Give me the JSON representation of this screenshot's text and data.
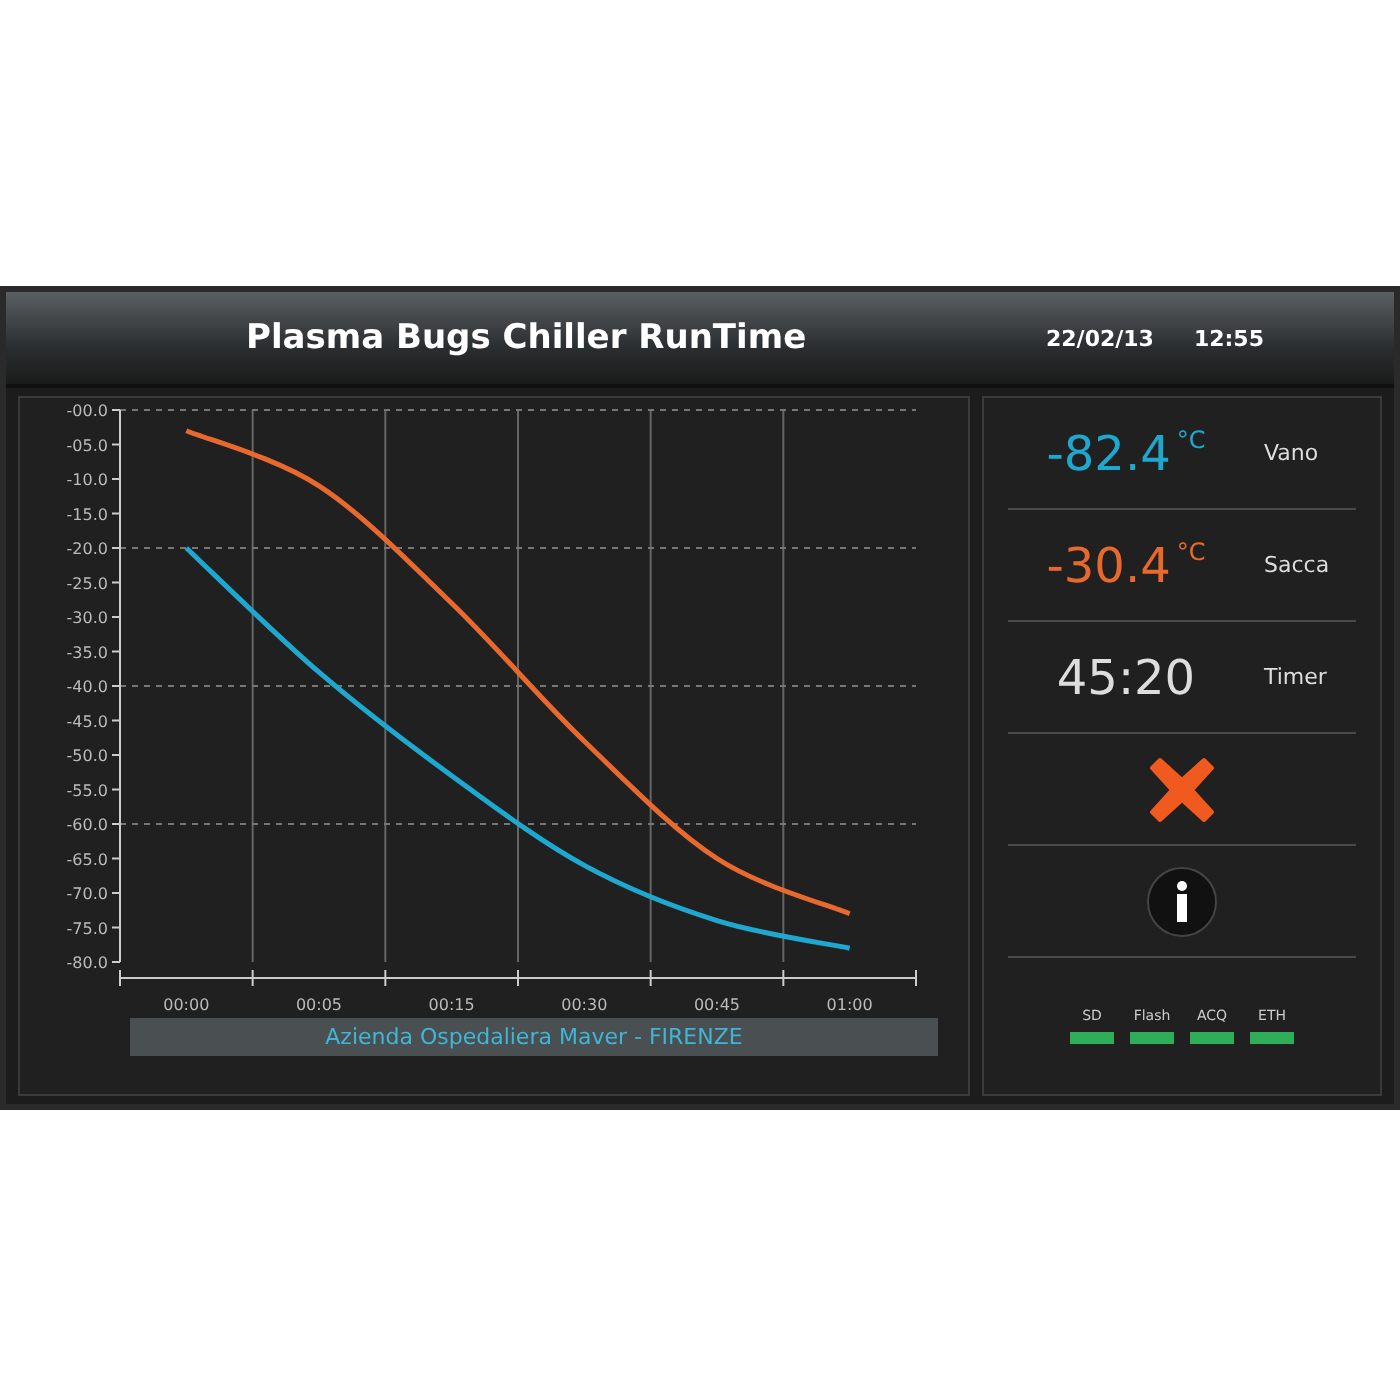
{
  "header": {
    "title": "Plasma Bugs Chiller RunTime",
    "date": "22/02/13",
    "time": "12:55"
  },
  "chart": {
    "chart_data": {
      "type": "line",
      "grid": true,
      "ylim": [
        -80,
        0
      ],
      "yticks": [
        {
          "value": 0,
          "label": "-00.0"
        },
        {
          "value": -5,
          "label": "-05.0"
        },
        {
          "value": -10,
          "label": "-10.0"
        },
        {
          "value": -15,
          "label": "-15.0"
        },
        {
          "value": -20,
          "label": "-20.0"
        },
        {
          "value": -25,
          "label": "-25.0"
        },
        {
          "value": -30,
          "label": "-30.0"
        },
        {
          "value": -35,
          "label": "-35.0"
        },
        {
          "value": -40,
          "label": "-40.0"
        },
        {
          "value": -45,
          "label": "-45.0"
        },
        {
          "value": -50,
          "label": "-50.0"
        },
        {
          "value": -55,
          "label": "-55.0"
        },
        {
          "value": -60,
          "label": "-60.0"
        },
        {
          "value": -65,
          "label": "-65.0"
        },
        {
          "value": -70,
          "label": "-70.0"
        },
        {
          "value": -75,
          "label": "-75.0"
        },
        {
          "value": -80,
          "label": "-80.0"
        }
      ],
      "categories": [
        "00:00",
        "00:05",
        "00:15",
        "00:30",
        "00:45",
        "01:00"
      ],
      "series": [
        {
          "color": "#e8692e",
          "values": [
            -3,
            -11,
            -28,
            -48,
            -65,
            -73
          ]
        },
        {
          "color": "#1fa8cf",
          "values": [
            -20,
            -38,
            -53,
            -66,
            -74,
            -78
          ]
        }
      ]
    },
    "caption": "Azienda Ospedaliera Maver - FIRENZE"
  },
  "readings": [
    {
      "kind": "temperature",
      "value": "-82.4",
      "unit": "°C",
      "label": "Vano",
      "color": "#1fa8cf"
    },
    {
      "kind": "temperature",
      "value": "-30.4",
      "unit": "°C",
      "label": "Sacca",
      "color": "#e8692e"
    },
    {
      "kind": "timer",
      "value": "45:20",
      "label": "Timer"
    }
  ],
  "indicators": [
    {
      "label": "SD",
      "on": true
    },
    {
      "label": "Flash",
      "on": true
    },
    {
      "label": "ACQ",
      "on": true
    },
    {
      "label": "ETH",
      "on": true
    }
  ]
}
